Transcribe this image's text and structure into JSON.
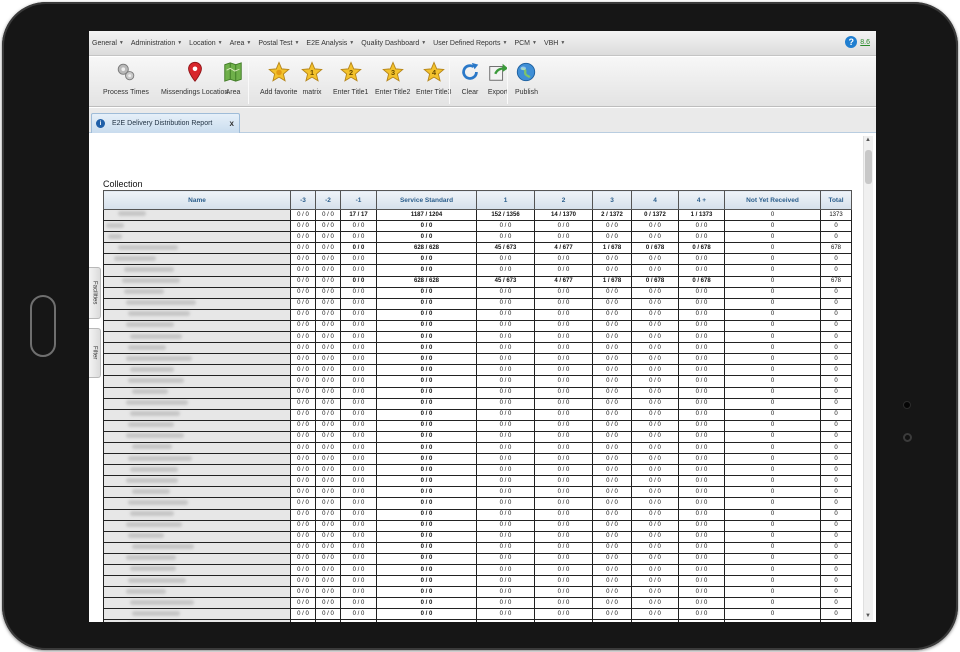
{
  "menu": {
    "items": [
      "General",
      "Administration",
      "Location",
      "Area",
      "Postal Test",
      "E2E Analysis",
      "Quality Dashboard",
      "User Defined Reports",
      "PCM",
      "VBH"
    ],
    "help_symbol": "?",
    "version": "8.6"
  },
  "toolbar": {
    "groups": [
      [
        {
          "label": "Process Times",
          "icon": "gears-icon"
        },
        {
          "label": "Missendings Location",
          "icon": "map-pin-icon"
        },
        {
          "label": "Area",
          "icon": "map-icon"
        }
      ],
      [
        {
          "label": "Add favorite",
          "icon": "star-add-icon"
        },
        {
          "label": "matrix",
          "icon": "star-1-icon",
          "num": "1"
        },
        {
          "label": "Enter Title1",
          "icon": "star-2-icon",
          "num": "2"
        },
        {
          "label": "Enter Title2",
          "icon": "star-3-icon",
          "num": "3"
        },
        {
          "label": "Enter Title3",
          "icon": "star-4-icon",
          "num": "4"
        }
      ],
      [
        {
          "label": "Clear",
          "icon": "refresh-icon"
        },
        {
          "label": "Export",
          "icon": "export-icon"
        }
      ],
      [
        {
          "label": "Publish",
          "icon": "globe-icon"
        }
      ]
    ]
  },
  "tab": {
    "label": "E2E Delivery Distribution Report",
    "close": "x",
    "icon_letter": "i"
  },
  "side_tabs": [
    "Facilities",
    "Filter"
  ],
  "content": {
    "section_title": "Collection"
  },
  "table": {
    "headers": [
      "Name",
      "-3",
      "-2",
      "-1",
      "Service Standard",
      "1",
      "2",
      "3",
      "4",
      "4 +",
      "Not Yet Received",
      "Total"
    ],
    "rows": [
      {
        "cells": [
          "0 / 0",
          "0 / 0",
          "17 / 17",
          "1187 / 1204",
          "152 / 1356",
          "14 / 1370",
          "2 / 1372",
          "0 / 1372",
          "1 / 1373",
          "0",
          "1373"
        ],
        "bold": true
      },
      {
        "cells": [
          "0 / 0",
          "0 / 0",
          "0 / 0",
          "0 / 0",
          "0 / 0",
          "0 / 0",
          "0 / 0",
          "0 / 0",
          "0 / 0",
          "0",
          "0"
        ]
      },
      {
        "cells": [
          "0 / 0",
          "0 / 0",
          "0 / 0",
          "0 / 0",
          "0 / 0",
          "0 / 0",
          "0 / 0",
          "0 / 0",
          "0 / 0",
          "0",
          "0"
        ]
      },
      {
        "cells": [
          "0 / 0",
          "0 / 0",
          "0 / 0",
          "628 / 628",
          "45 / 673",
          "4 / 677",
          "1 / 678",
          "0 / 678",
          "0 / 678",
          "0",
          "678"
        ],
        "bold": true
      },
      {
        "cells": [
          "0 / 0",
          "0 / 0",
          "0 / 0",
          "0 / 0",
          "0 / 0",
          "0 / 0",
          "0 / 0",
          "0 / 0",
          "0 / 0",
          "0",
          "0"
        ]
      },
      {
        "cells": [
          "0 / 0",
          "0 / 0",
          "0 / 0",
          "0 / 0",
          "0 / 0",
          "0 / 0",
          "0 / 0",
          "0 / 0",
          "0 / 0",
          "0",
          "0"
        ]
      },
      {
        "cells": [
          "0 / 0",
          "0 / 0",
          "0 / 0",
          "628 / 628",
          "45 / 673",
          "4 / 677",
          "1 / 678",
          "0 / 678",
          "0 / 678",
          "0",
          "678"
        ],
        "bold": true
      },
      {
        "cells": [
          "0 / 0",
          "0 / 0",
          "0 / 0",
          "0 / 0",
          "0 / 0",
          "0 / 0",
          "0 / 0",
          "0 / 0",
          "0 / 0",
          "0",
          "0"
        ]
      },
      {
        "cells": [
          "0 / 0",
          "0 / 0",
          "0 / 0",
          "0 / 0",
          "0 / 0",
          "0 / 0",
          "0 / 0",
          "0 / 0",
          "0 / 0",
          "0",
          "0"
        ]
      },
      {
        "cells": [
          "0 / 0",
          "0 / 0",
          "0 / 0",
          "0 / 0",
          "0 / 0",
          "0 / 0",
          "0 / 0",
          "0 / 0",
          "0 / 0",
          "0",
          "0"
        ]
      },
      {
        "cells": [
          "0 / 0",
          "0 / 0",
          "0 / 0",
          "0 / 0",
          "0 / 0",
          "0 / 0",
          "0 / 0",
          "0 / 0",
          "0 / 0",
          "0",
          "0"
        ]
      },
      {
        "cells": [
          "0 / 0",
          "0 / 0",
          "0 / 0",
          "0 / 0",
          "0 / 0",
          "0 / 0",
          "0 / 0",
          "0 / 0",
          "0 / 0",
          "0",
          "0"
        ]
      },
      {
        "cells": [
          "0 / 0",
          "0 / 0",
          "0 / 0",
          "0 / 0",
          "0 / 0",
          "0 / 0",
          "0 / 0",
          "0 / 0",
          "0 / 0",
          "0",
          "0"
        ]
      },
      {
        "cells": [
          "0 / 0",
          "0 / 0",
          "0 / 0",
          "0 / 0",
          "0 / 0",
          "0 / 0",
          "0 / 0",
          "0 / 0",
          "0 / 0",
          "0",
          "0"
        ]
      },
      {
        "cells": [
          "0 / 0",
          "0 / 0",
          "0 / 0",
          "0 / 0",
          "0 / 0",
          "0 / 0",
          "0 / 0",
          "0 / 0",
          "0 / 0",
          "0",
          "0"
        ]
      },
      {
        "cells": [
          "0 / 0",
          "0 / 0",
          "0 / 0",
          "0 / 0",
          "0 / 0",
          "0 / 0",
          "0 / 0",
          "0 / 0",
          "0 / 0",
          "0",
          "0"
        ]
      },
      {
        "cells": [
          "0 / 0",
          "0 / 0",
          "0 / 0",
          "0 / 0",
          "0 / 0",
          "0 / 0",
          "0 / 0",
          "0 / 0",
          "0 / 0",
          "0",
          "0"
        ]
      },
      {
        "cells": [
          "0 / 0",
          "0 / 0",
          "0 / 0",
          "0 / 0",
          "0 / 0",
          "0 / 0",
          "0 / 0",
          "0 / 0",
          "0 / 0",
          "0",
          "0"
        ]
      },
      {
        "cells": [
          "0 / 0",
          "0 / 0",
          "0 / 0",
          "0 / 0",
          "0 / 0",
          "0 / 0",
          "0 / 0",
          "0 / 0",
          "0 / 0",
          "0",
          "0"
        ]
      },
      {
        "cells": [
          "0 / 0",
          "0 / 0",
          "0 / 0",
          "0 / 0",
          "0 / 0",
          "0 / 0",
          "0 / 0",
          "0 / 0",
          "0 / 0",
          "0",
          "0"
        ]
      },
      {
        "cells": [
          "0 / 0",
          "0 / 0",
          "0 / 0",
          "0 / 0",
          "0 / 0",
          "0 / 0",
          "0 / 0",
          "0 / 0",
          "0 / 0",
          "0",
          "0"
        ]
      },
      {
        "cells": [
          "0 / 0",
          "0 / 0",
          "0 / 0",
          "0 / 0",
          "0 / 0",
          "0 / 0",
          "0 / 0",
          "0 / 0",
          "0 / 0",
          "0",
          "0"
        ]
      },
      {
        "cells": [
          "0 / 0",
          "0 / 0",
          "0 / 0",
          "0 / 0",
          "0 / 0",
          "0 / 0",
          "0 / 0",
          "0 / 0",
          "0 / 0",
          "0",
          "0"
        ]
      },
      {
        "cells": [
          "0 / 0",
          "0 / 0",
          "0 / 0",
          "0 / 0",
          "0 / 0",
          "0 / 0",
          "0 / 0",
          "0 / 0",
          "0 / 0",
          "0",
          "0"
        ]
      },
      {
        "cells": [
          "0 / 0",
          "0 / 0",
          "0 / 0",
          "0 / 0",
          "0 / 0",
          "0 / 0",
          "0 / 0",
          "0 / 0",
          "0 / 0",
          "0",
          "0"
        ]
      },
      {
        "cells": [
          "0 / 0",
          "0 / 0",
          "0 / 0",
          "0 / 0",
          "0 / 0",
          "0 / 0",
          "0 / 0",
          "0 / 0",
          "0 / 0",
          "0",
          "0"
        ]
      },
      {
        "cells": [
          "0 / 0",
          "0 / 0",
          "0 / 0",
          "0 / 0",
          "0 / 0",
          "0 / 0",
          "0 / 0",
          "0 / 0",
          "0 / 0",
          "0",
          "0"
        ]
      },
      {
        "cells": [
          "0 / 0",
          "0 / 0",
          "0 / 0",
          "0 / 0",
          "0 / 0",
          "0 / 0",
          "0 / 0",
          "0 / 0",
          "0 / 0",
          "0",
          "0"
        ]
      },
      {
        "cells": [
          "0 / 0",
          "0 / 0",
          "0 / 0",
          "0 / 0",
          "0 / 0",
          "0 / 0",
          "0 / 0",
          "0 / 0",
          "0 / 0",
          "0",
          "0"
        ]
      },
      {
        "cells": [
          "0 / 0",
          "0 / 0",
          "0 / 0",
          "0 / 0",
          "0 / 0",
          "0 / 0",
          "0 / 0",
          "0 / 0",
          "0 / 0",
          "0",
          "0"
        ]
      },
      {
        "cells": [
          "0 / 0",
          "0 / 0",
          "0 / 0",
          "0 / 0",
          "0 / 0",
          "0 / 0",
          "0 / 0",
          "0 / 0",
          "0 / 0",
          "0",
          "0"
        ]
      },
      {
        "cells": [
          "0 / 0",
          "0 / 0",
          "0 / 0",
          "0 / 0",
          "0 / 0",
          "0 / 0",
          "0 / 0",
          "0 / 0",
          "0 / 0",
          "0",
          "0"
        ]
      },
      {
        "cells": [
          "0 / 0",
          "0 / 0",
          "0 / 0",
          "0 / 0",
          "0 / 0",
          "0 / 0",
          "0 / 0",
          "0 / 0",
          "0 / 0",
          "0",
          "0"
        ]
      },
      {
        "cells": [
          "0 / 0",
          "0 / 0",
          "0 / 0",
          "0 / 0",
          "0 / 0",
          "0 / 0",
          "0 / 0",
          "0 / 0",
          "0 / 0",
          "0",
          "0"
        ]
      },
      {
        "cells": [
          "0 / 0",
          "0 / 0",
          "0 / 0",
          "0 / 0",
          "0 / 0",
          "0 / 0",
          "0 / 0",
          "0 / 0",
          "0 / 0",
          "0",
          "0"
        ]
      },
      {
        "cells": [
          "0 / 0",
          "0 / 0",
          "0 / 0",
          "0 / 0",
          "0 / 0",
          "0 / 0",
          "0 / 0",
          "0 / 0",
          "0 / 0",
          "0",
          "0"
        ]
      },
      {
        "cells": [
          "0 / 0",
          "0 / 0",
          "0 / 0",
          "0 / 0",
          "0 / 0",
          "0 / 0",
          "0 / 0",
          "0 / 0",
          "0 / 0",
          "0",
          "0"
        ]
      },
      {
        "cells": [
          "0 / 0",
          "0 / 0",
          "0 / 0",
          "0 / 0",
          "0 / 0",
          "0 / 0",
          "0 / 0",
          "0 / 0",
          "0 / 0",
          "0",
          "0"
        ]
      }
    ]
  },
  "colors": {
    "accent_header_text": "#2b5e8c",
    "help_blue": "#1f7ed0",
    "version_green": "#2a8a2a"
  }
}
